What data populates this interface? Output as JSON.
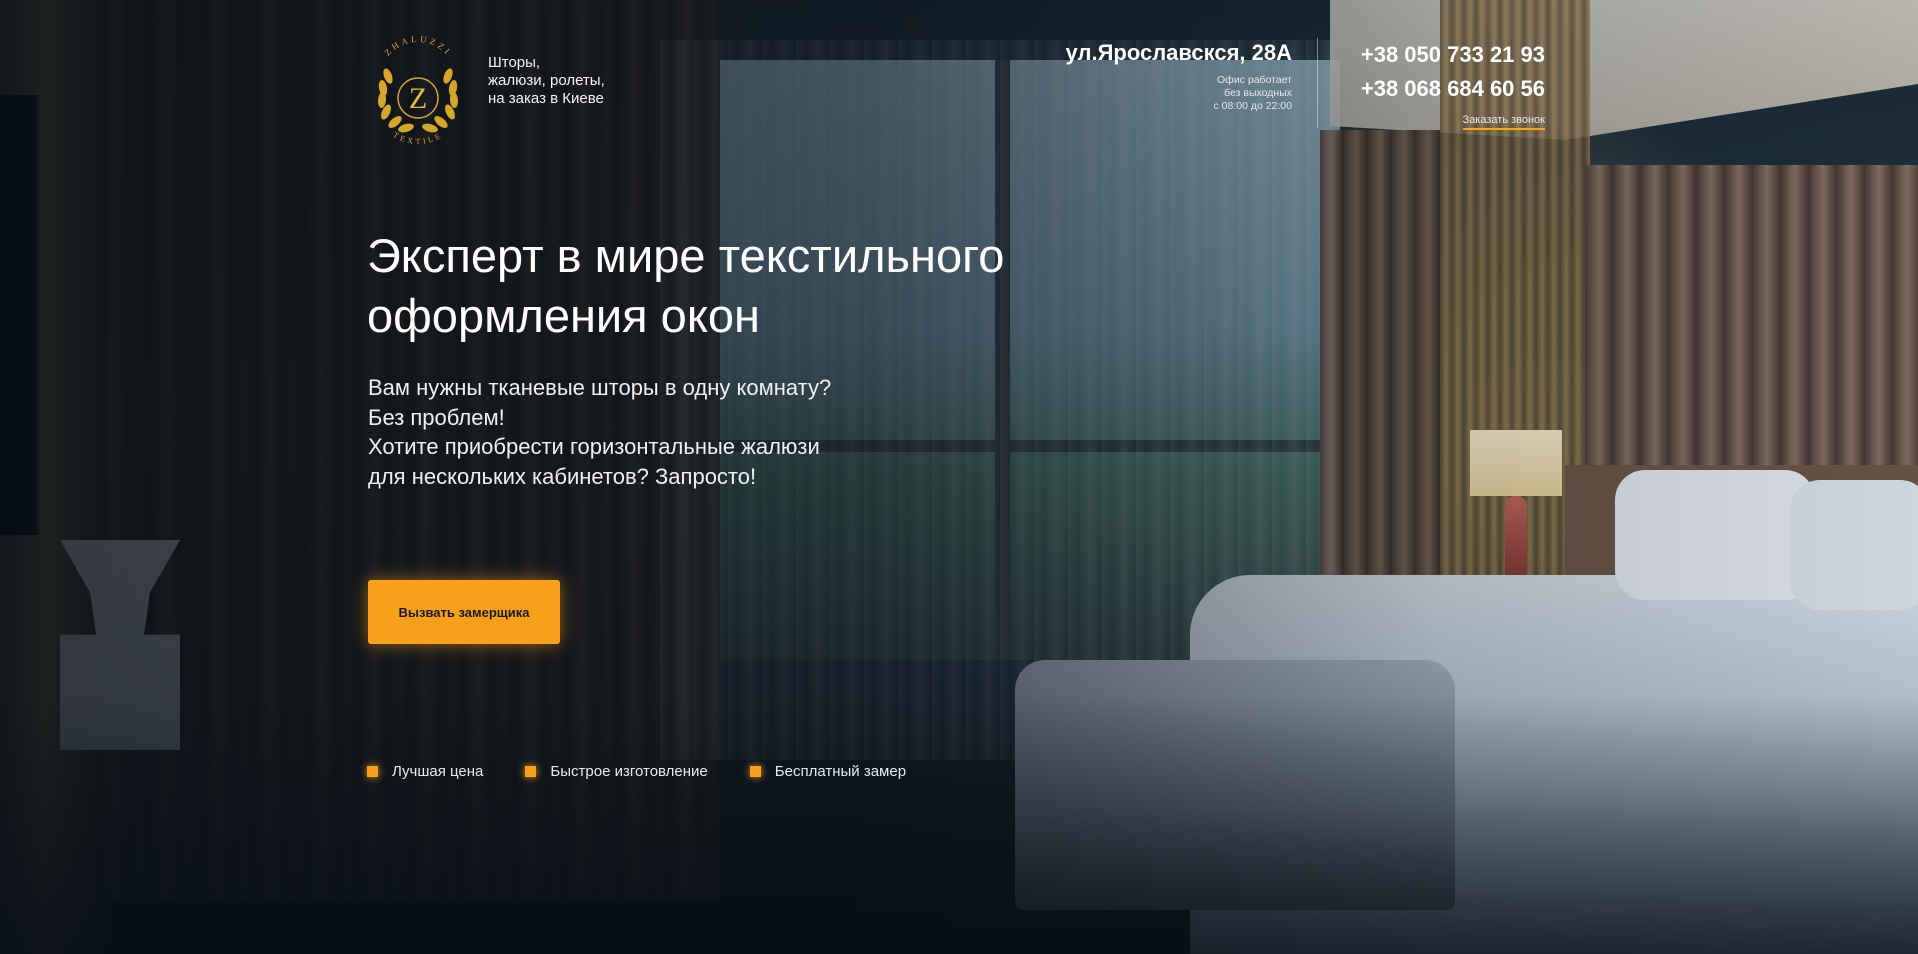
{
  "header": {
    "logo": {
      "letter": "Z",
      "top_text": "ZHALUZZI",
      "bottom_text": "TEXTILE"
    },
    "tagline": [
      "Шторы,",
      "жалюзи, ролеты,",
      "на заказ в Киеве"
    ],
    "address": {
      "street": "ул.Ярославскся, 28А",
      "hours": [
        "Офис работает",
        "без выходных",
        "с 08:00 до 22:00"
      ]
    },
    "phones": [
      "+38 050 733 21 93",
      "+38 068 684 60 56"
    ],
    "callback_label": "Заказать звонок"
  },
  "hero": {
    "headline": [
      "Эксперт в мире текстильного",
      "оформления окон"
    ],
    "lead": [
      "Вам нужны тканевые шторы в одну комнату?",
      "Без проблем!",
      "Хотите приобрести горизонтальные жалюзи",
      "для нескольких кабинетов? Запросто!"
    ],
    "cta_label": "Вызвать замерщика",
    "features": [
      "Лучшая цена",
      "Быстрое изготовление",
      "Бесплатный замер"
    ]
  },
  "colors": {
    "accent": "#f9a01b",
    "logo_gold": "#d4a62a",
    "text": "#ffffff"
  },
  "icons": {
    "logo": "laurel-wreath-emblem",
    "feature_bullet": "square-bullet"
  }
}
